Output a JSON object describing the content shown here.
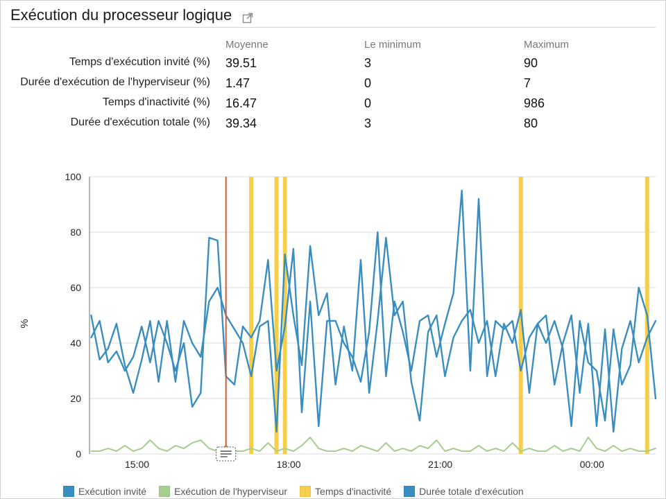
{
  "title": "Exécution du processeur logique",
  "stats": {
    "headers": {
      "avg": "Moyenne",
      "min": "Le minimum",
      "max": "Maximum"
    },
    "rows": [
      {
        "label": "Temps d'exécution invité (%)",
        "avg": "39.51",
        "min": "3",
        "max": "90"
      },
      {
        "label": "Durée d'exécution de l'hyperviseur (%)",
        "avg": "1.47",
        "min": "0",
        "max": "7"
      },
      {
        "label": "Temps d'inactivité (%)",
        "avg": "16.47",
        "min": "0",
        "max": "986"
      },
      {
        "label": "Durée d'exécution totale (%)",
        "avg": "39.34",
        "min": "3",
        "max": "80"
      }
    ]
  },
  "chart": {
    "ylabel": "%",
    "ylim": [
      0,
      100
    ],
    "x_categories": [
      "15:00",
      "18:00",
      "21:00",
      "00:00"
    ],
    "x_domain_hours": [
      14.3,
      25.5
    ],
    "colors": {
      "guest": "#3a8dbf",
      "hyper": "#a6ce8f",
      "idle": "#f5cf4b",
      "total": "#3a8dbf",
      "marker": "#d55a3a",
      "grid": "#d9dcdd",
      "axis": "#6b6e70"
    },
    "legend": [
      {
        "label": "Exécution invité",
        "key": "guest"
      },
      {
        "label": "Exécution de l'hyperviseur",
        "key": "hyper"
      },
      {
        "label": "Temps d'inactivité",
        "key": "idle"
      },
      {
        "label": "Durée totale d'exécution",
        "key": "total"
      }
    ]
  },
  "chart_data": {
    "type": "line",
    "title": "Exécution du processeur logique",
    "xlabel": "",
    "ylabel": "%",
    "ylim": [
      0,
      100
    ],
    "x": [
      "14:20",
      "14:30",
      "14:40",
      "14:50",
      "15:00",
      "15:10",
      "15:20",
      "15:30",
      "15:40",
      "15:50",
      "16:00",
      "16:10",
      "16:20",
      "16:30",
      "16:40",
      "16:50",
      "17:00",
      "17:10",
      "17:20",
      "17:30",
      "17:40",
      "17:50",
      "18:00",
      "18:10",
      "18:20",
      "18:30",
      "18:40",
      "18:50",
      "19:00",
      "19:10",
      "19:20",
      "19:30",
      "19:40",
      "19:50",
      "20:00",
      "20:10",
      "20:20",
      "20:30",
      "20:40",
      "20:50",
      "21:00",
      "21:10",
      "21:20",
      "21:30",
      "21:40",
      "21:50",
      "22:00",
      "22:10",
      "22:20",
      "22:30",
      "22:40",
      "22:50",
      "23:00",
      "23:10",
      "23:20",
      "23:30",
      "23:40",
      "23:50",
      "00:00",
      "00:10",
      "00:20",
      "00:30",
      "00:40",
      "00:50",
      "01:00",
      "01:10",
      "01:20",
      "01:30"
    ],
    "series": [
      {
        "name": "Exécution invité",
        "values": [
          42,
          48,
          33,
          37,
          30,
          35,
          46,
          33,
          48,
          40,
          30,
          40,
          17,
          22,
          78,
          77,
          28,
          25,
          46,
          42,
          48,
          70,
          30,
          46,
          74,
          15,
          55,
          10,
          48,
          48,
          40,
          35,
          26,
          44,
          80,
          28,
          55,
          44,
          30,
          48,
          50,
          35,
          47,
          58,
          95,
          30,
          92,
          28,
          48,
          45,
          48,
          30,
          42,
          47,
          50,
          25,
          40,
          50,
          22,
          47,
          10,
          45,
          8,
          38,
          48,
          33,
          42,
          48
        ]
      },
      {
        "name": "Durée totale d'exécution",
        "values": [
          50,
          34,
          38,
          47,
          32,
          22,
          34,
          48,
          26,
          48,
          26,
          48,
          40,
          35,
          55,
          60,
          50,
          45,
          40,
          28,
          46,
          48,
          8,
          72,
          50,
          32,
          75,
          50,
          58,
          25,
          46,
          30,
          70,
          22,
          48,
          78,
          50,
          55,
          26,
          12,
          44,
          50,
          28,
          42,
          48,
          52,
          40,
          48,
          28,
          47,
          40,
          52,
          22,
          47,
          40,
          48,
          38,
          10,
          48,
          33,
          30,
          12,
          45,
          25,
          32,
          60,
          50,
          20
        ]
      },
      {
        "name": "Exécution de l'hyperviseur",
        "values": [
          1,
          1,
          2,
          1,
          3,
          1,
          2,
          5,
          2,
          1,
          3,
          2,
          4,
          5,
          2,
          1,
          3,
          1,
          1,
          2,
          1,
          4,
          1,
          2,
          1,
          3,
          6,
          2,
          1,
          1,
          2,
          1,
          3,
          2,
          1,
          4,
          1,
          2,
          1,
          3,
          2,
          5,
          1,
          2,
          1,
          1,
          3,
          1,
          2,
          1,
          4,
          1,
          2,
          1,
          1,
          3,
          1,
          2,
          1,
          6,
          2,
          1,
          3,
          1,
          2,
          1,
          1,
          2
        ]
      },
      {
        "name": "Temps d'inactivité",
        "values": [
          0,
          0,
          0,
          0,
          0,
          0,
          0,
          0,
          0,
          0,
          0,
          0,
          0,
          0,
          0,
          0,
          0,
          0,
          0,
          400,
          0,
          0,
          160,
          300,
          0,
          0,
          0,
          0,
          0,
          0,
          0,
          0,
          0,
          0,
          0,
          0,
          0,
          0,
          0,
          0,
          0,
          0,
          0,
          0,
          0,
          0,
          0,
          0,
          0,
          0,
          0,
          500,
          0,
          0,
          0,
          0,
          0,
          0,
          0,
          0,
          0,
          0,
          0,
          0,
          0,
          0,
          700,
          0
        ]
      }
    ],
    "time_marker": "17:00",
    "grid": true,
    "legend_position": "bottom"
  }
}
